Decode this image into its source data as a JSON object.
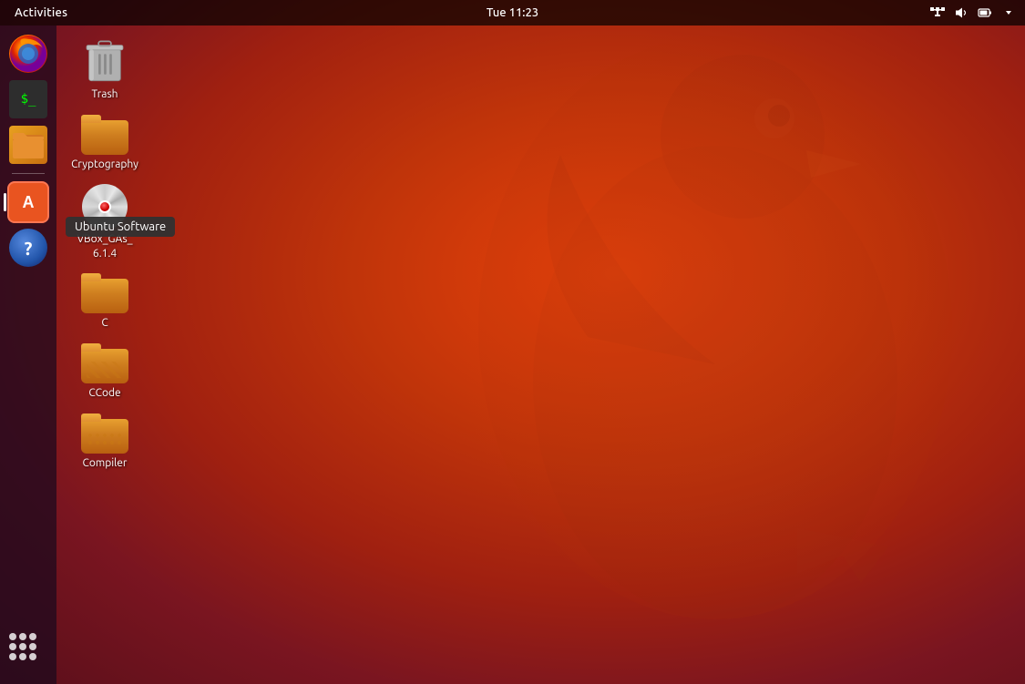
{
  "panel": {
    "activities_label": "Activities",
    "time": "Tue 11:23"
  },
  "dock": {
    "items": [
      {
        "id": "firefox",
        "label": "Firefox",
        "active": false
      },
      {
        "id": "terminal",
        "label": "Terminal",
        "active": false
      },
      {
        "id": "files",
        "label": "Files",
        "active": false
      },
      {
        "id": "ubuntu-software",
        "label": "Ubuntu Software",
        "active": true,
        "tooltip": "Ubuntu Software"
      },
      {
        "id": "help",
        "label": "Help",
        "active": false
      }
    ],
    "apps_grid_label": "Show Applications"
  },
  "desktop_icons": [
    {
      "id": "trash",
      "label": "Trash",
      "type": "trash"
    },
    {
      "id": "cryptography",
      "label": "Cryptography",
      "type": "folder"
    },
    {
      "id": "vbox-gas",
      "label": "VBox_GAs_\n6.1.4",
      "type": "cd"
    },
    {
      "id": "c-folder",
      "label": "C",
      "type": "folder"
    },
    {
      "id": "ccode",
      "label": "CCode",
      "type": "folder-stripe"
    },
    {
      "id": "compiler",
      "label": "Compiler",
      "type": "folder-dots"
    }
  ],
  "tooltip": {
    "text": "Ubuntu Software"
  }
}
